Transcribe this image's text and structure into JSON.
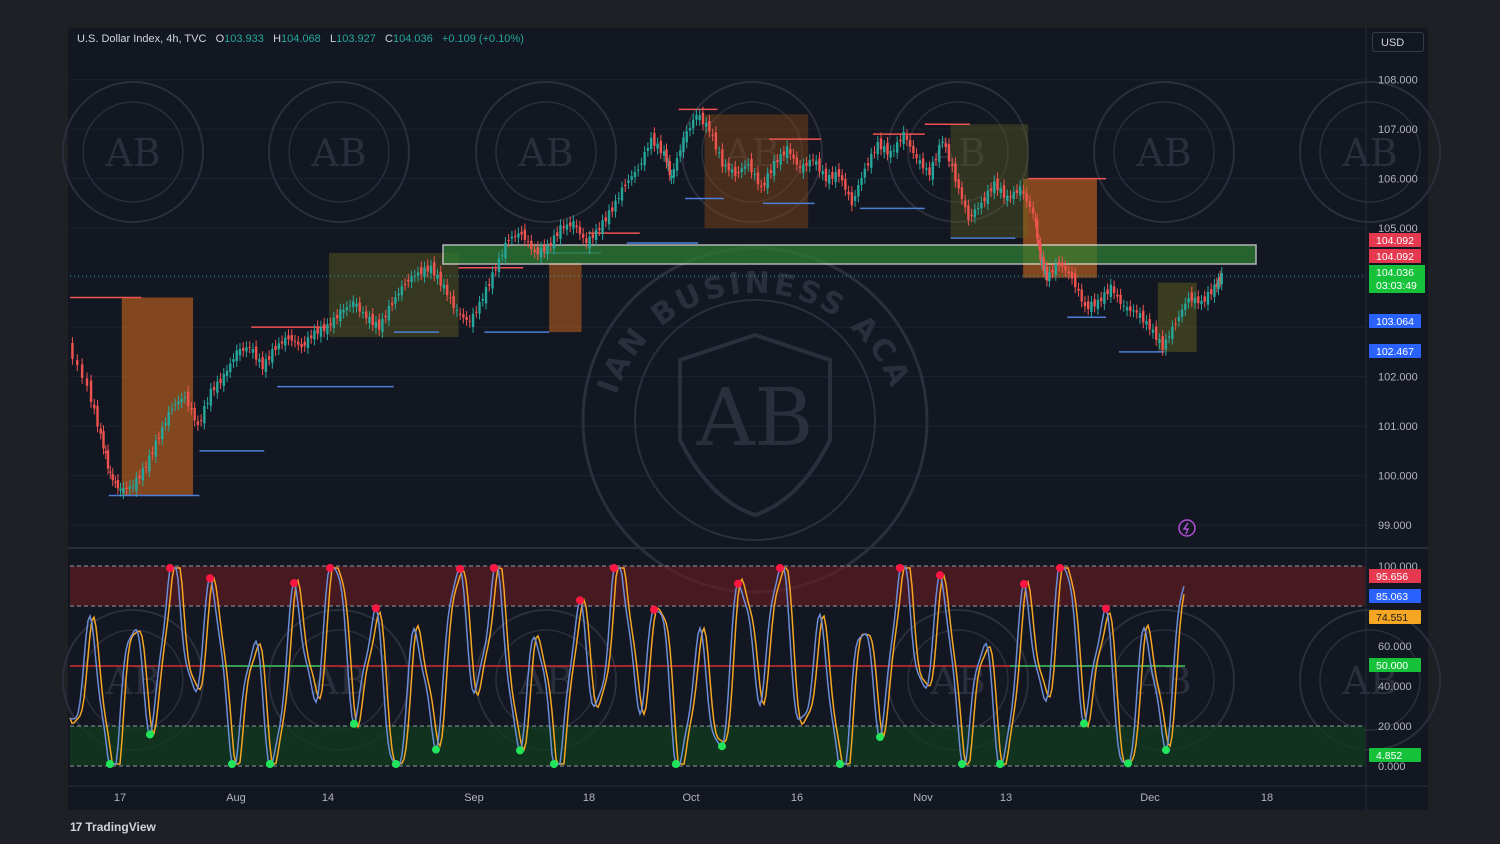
{
  "header": {
    "symbol": "U.S. Dollar Index, 4h, TVC",
    "open_label": "O",
    "open": "103.933",
    "high_label": "H",
    "high": "104.068",
    "low_label": "L",
    "low": "103.927",
    "close_label": "C",
    "close": "104.036",
    "change": "+0.109 (+0.10%)"
  },
  "currency_button": "USD",
  "brand": {
    "logo": "17",
    "name": "TradingView"
  },
  "watermark": {
    "text": "ARABIAN BUSINESS ACADEMY",
    "initials": "AB"
  },
  "price_badges": {
    "red_1": "104.092",
    "red_2": "104.092",
    "last": "104.036",
    "countdown": "03:03:49",
    "blue_1": "103.064",
    "blue_2": "102.467"
  },
  "osc_badges": {
    "red": "95.656",
    "blue": "85.063",
    "orange": "74.551",
    "green_mid": "50.000",
    "green_low": "4.852"
  },
  "colors": {
    "up": "#26a69a",
    "down": "#ef5350",
    "blue_line": "#4d7fd6",
    "orange_line": "#f5a623",
    "zone_green": "#2e7d32",
    "zone_red": "#6b1a22",
    "box_orange": "#b35c1e"
  },
  "chart_data": [
    {
      "type": "line",
      "name_hint": "price",
      "x_ticks": [
        "17",
        "Aug",
        "14",
        "Sep",
        "18",
        "Oct",
        "16",
        "Nov",
        "13",
        "Dec",
        "18"
      ],
      "y_ticks": [
        "108.000",
        "107.000",
        "106.000",
        "105.000",
        "102.000",
        "101.000",
        "100.000",
        "99.000"
      ],
      "y_range": [
        98.7,
        108.6
      ],
      "x_range": [
        0,
        100
      ],
      "points": [
        [
          0,
          102.6
        ],
        [
          1.5,
          101.8
        ],
        [
          2.5,
          100.8
        ],
        [
          3.2,
          100.0
        ],
        [
          4.0,
          99.7
        ],
        [
          5.0,
          99.8
        ],
        [
          6.0,
          100.2
        ],
        [
          7.0,
          100.8
        ],
        [
          8.0,
          101.4
        ],
        [
          9.0,
          101.6
        ],
        [
          10.0,
          101.0
        ],
        [
          11.0,
          101.7
        ],
        [
          12.0,
          102.0
        ],
        [
          13.0,
          102.5
        ],
        [
          14.0,
          102.6
        ],
        [
          15.0,
          102.2
        ],
        [
          16.0,
          102.6
        ],
        [
          17.0,
          102.8
        ],
        [
          18.0,
          102.6
        ],
        [
          19.0,
          102.9
        ],
        [
          20.0,
          103.0
        ],
        [
          21.0,
          103.3
        ],
        [
          22.0,
          103.5
        ],
        [
          23.0,
          103.2
        ],
        [
          24.0,
          103.0
        ],
        [
          25.0,
          103.5
        ],
        [
          26.0,
          103.9
        ],
        [
          27.0,
          104.1
        ],
        [
          28.0,
          104.2
        ],
        [
          29.0,
          103.8
        ],
        [
          30.0,
          103.3
        ],
        [
          31.0,
          103.1
        ],
        [
          32.0,
          103.6
        ],
        [
          33.0,
          104.2
        ],
        [
          34.0,
          104.8
        ],
        [
          35.0,
          104.9
        ],
        [
          36.0,
          104.5
        ],
        [
          37.0,
          104.6
        ],
        [
          38.0,
          105.0
        ],
        [
          39.0,
          105.1
        ],
        [
          40.0,
          104.7
        ],
        [
          41.0,
          105.0
        ],
        [
          42.0,
          105.4
        ],
        [
          43.0,
          105.9
        ],
        [
          44.0,
          106.2
        ],
        [
          45.0,
          106.8
        ],
        [
          46.0,
          106.5
        ],
        [
          46.5,
          106.0
        ],
        [
          47.5,
          106.8
        ],
        [
          48.5,
          107.3
        ],
        [
          49.5,
          107.0
        ],
        [
          50.5,
          106.3
        ],
        [
          51.5,
          106.1
        ],
        [
          52.5,
          106.3
        ],
        [
          53.5,
          105.8
        ],
        [
          54.5,
          106.3
        ],
        [
          55.5,
          106.6
        ],
        [
          56.5,
          106.2
        ],
        [
          57.5,
          106.4
        ],
        [
          58.5,
          106.0
        ],
        [
          59.5,
          106.1
        ],
        [
          60.5,
          105.5
        ],
        [
          61.5,
          106.2
        ],
        [
          62.5,
          106.7
        ],
        [
          63.5,
          106.5
        ],
        [
          64.5,
          106.9
        ],
        [
          65.5,
          106.4
        ],
        [
          66.5,
          106.1
        ],
        [
          67.5,
          106.8
        ],
        [
          68.5,
          106.0
        ],
        [
          69.5,
          105.2
        ],
        [
          70.5,
          105.5
        ],
        [
          71.5,
          105.9
        ],
        [
          72.5,
          105.6
        ],
        [
          73.5,
          105.8
        ],
        [
          74.5,
          105.3
        ],
        [
          75.0,
          104.4
        ],
        [
          75.5,
          104.0
        ],
        [
          76.5,
          104.3
        ],
        [
          77.5,
          104.0
        ],
        [
          78.5,
          103.4
        ],
        [
          79.5,
          103.5
        ],
        [
          80.5,
          103.8
        ],
        [
          81.5,
          103.4
        ],
        [
          82.5,
          103.3
        ],
        [
          83.5,
          103.0
        ],
        [
          84.5,
          102.6
        ],
        [
          85.5,
          103.1
        ],
        [
          86.5,
          103.6
        ],
        [
          87.5,
          103.5
        ],
        [
          88.5,
          103.8
        ],
        [
          89.0,
          104.036
        ]
      ],
      "marked_levels": [
        "104.092",
        "104.036",
        "103.064",
        "102.467"
      ]
    },
    {
      "type": "line",
      "name_hint": "stochastic oscillator",
      "y_ticks": [
        "100.000",
        "60.000",
        "40.000",
        "20.000",
        "0.000"
      ],
      "y_range": [
        0,
        100
      ],
      "bands": {
        "overbought": [
          80,
          100
        ],
        "oversold": [
          0,
          20
        ],
        "midline": 50
      },
      "last_values": [
        "95.656",
        "85.063",
        "74.551",
        "50.000",
        "4.852"
      ]
    }
  ]
}
